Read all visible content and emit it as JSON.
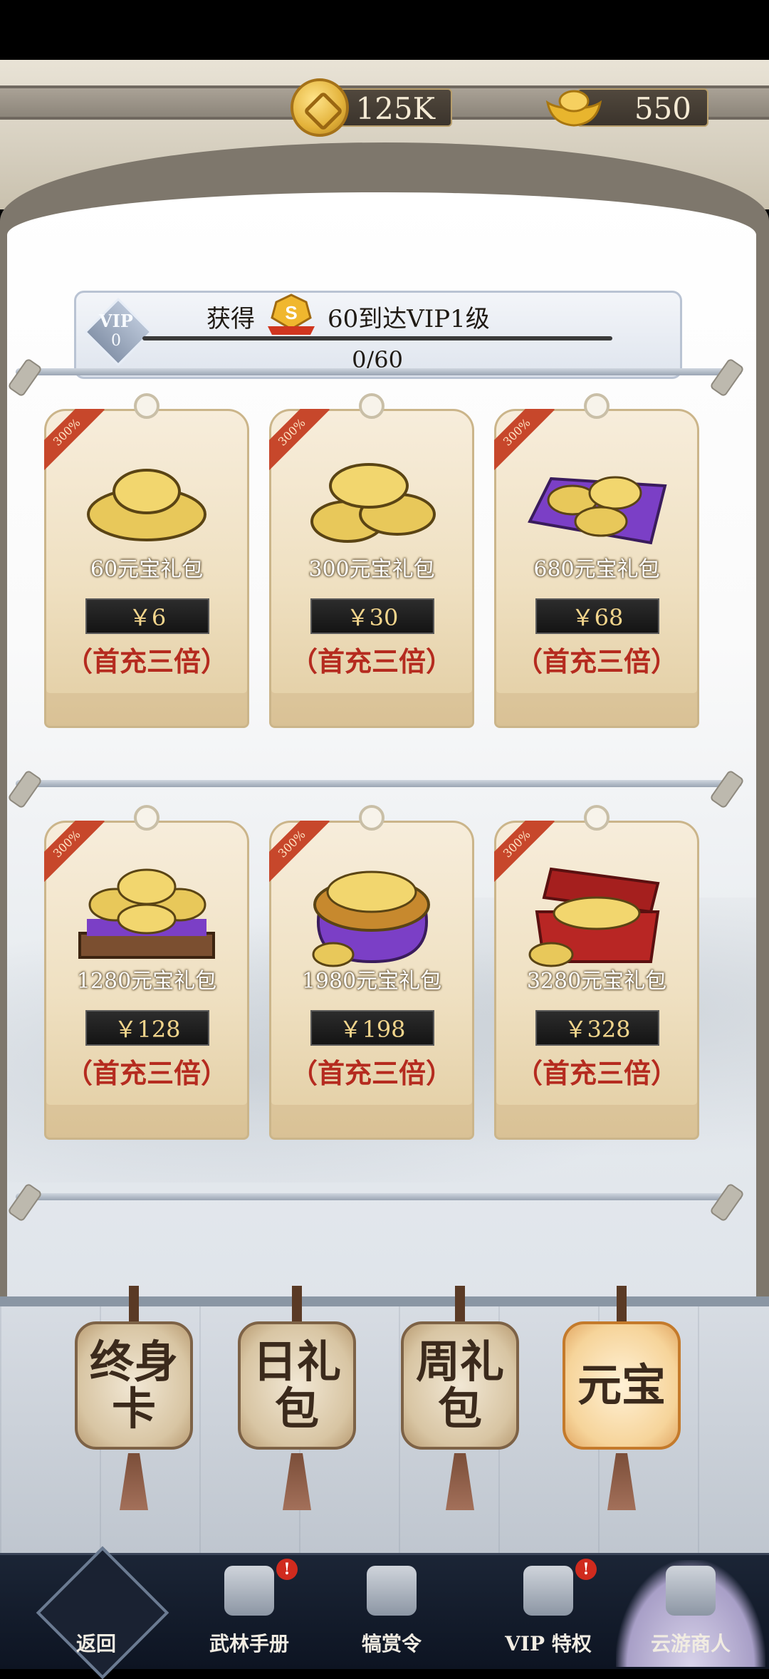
{
  "currency": {
    "coins": "125K",
    "ingots": "550"
  },
  "vip": {
    "icon_label": "VIP",
    "current_level": "0",
    "gain_prefix": "获得",
    "badge_text": "S",
    "goal_text": "60到达VIP1级",
    "progress_text": "0/60",
    "progress_fraction": 0
  },
  "ribbon_text": "300%",
  "packs": [
    {
      "name": "60元宝礼包",
      "price": "￥6",
      "bonus": "（首充三倍）"
    },
    {
      "name": "300元宝礼包",
      "price": "￥30",
      "bonus": "（首充三倍）"
    },
    {
      "name": "680元宝礼包",
      "price": "￥68",
      "bonus": "（首充三倍）"
    },
    {
      "name": "1280元宝礼包",
      "price": "￥128",
      "bonus": "（首充三倍）"
    },
    {
      "name": "1980元宝礼包",
      "price": "￥198",
      "bonus": "（首充三倍）"
    },
    {
      "name": "3280元宝礼包",
      "price": "￥328",
      "bonus": "（首充三倍）"
    }
  ],
  "lantern_tabs": [
    {
      "label": "终身卡",
      "active": false
    },
    {
      "label": "日礼包",
      "active": false
    },
    {
      "label": "周礼包",
      "active": false
    },
    {
      "label": "元宝",
      "active": true
    }
  ],
  "bottom_nav": [
    {
      "label": "返回"
    },
    {
      "label": "武林手册",
      "alert": "!"
    },
    {
      "label": "犒赏令"
    },
    {
      "label": "VIP 特权",
      "alert": "!"
    },
    {
      "label": "云游商人",
      "active": true
    }
  ],
  "colors": {
    "accent_red": "#b52b1f",
    "price_gold": "#f2d58c"
  }
}
